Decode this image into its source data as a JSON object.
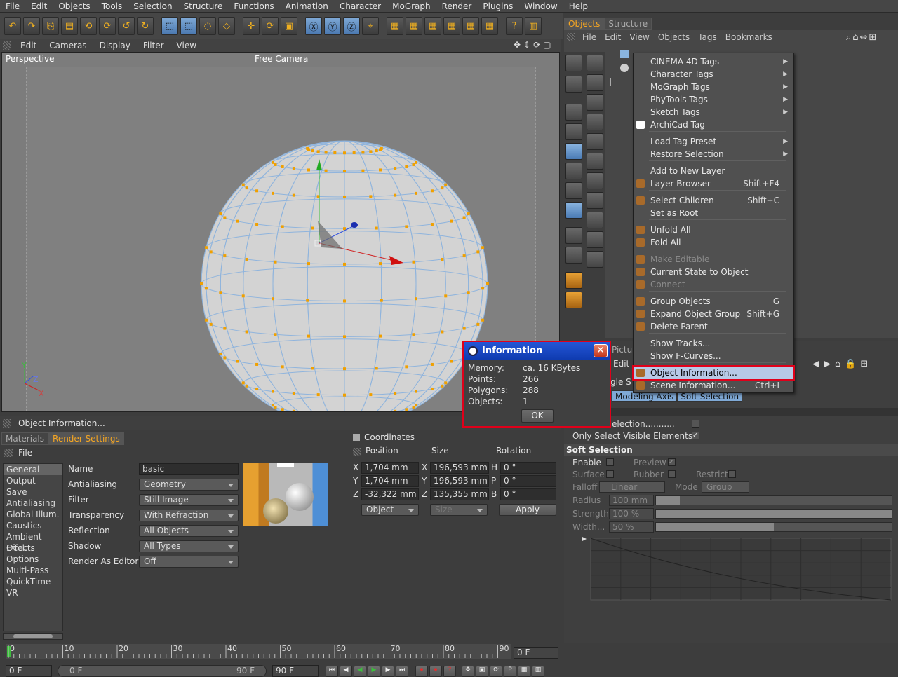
{
  "menubar": [
    "File",
    "Edit",
    "Objects",
    "Tools",
    "Selection",
    "Structure",
    "Functions",
    "Animation",
    "Character",
    "MoGraph",
    "Render",
    "Plugins",
    "Window",
    "Help"
  ],
  "viewport": {
    "menu": [
      "Edit",
      "Cameras",
      "Display",
      "Filter",
      "View"
    ],
    "label": "Perspective",
    "camera": "Free Camera"
  },
  "objects_panel": {
    "tabs": [
      "Objects",
      "Structure"
    ],
    "menu": [
      "File",
      "Edit",
      "View",
      "Objects",
      "Tags",
      "Bookmarks"
    ]
  },
  "context_menu": [
    {
      "label": "CINEMA 4D Tags",
      "arrow": true
    },
    {
      "label": "Character Tags",
      "arrow": true
    },
    {
      "label": "MoGraph Tags",
      "arrow": true
    },
    {
      "label": "PhyTools Tags",
      "arrow": true
    },
    {
      "label": "Sketch Tags",
      "arrow": true
    },
    {
      "label": "ArchiCad Tag"
    },
    {
      "label": "Load Tag Preset",
      "arrow": true
    },
    {
      "label": "Restore Selection",
      "arrow": true
    },
    {
      "label": "Add to New Layer"
    },
    {
      "label": "Layer Browser",
      "shortcut": "Shift+F4"
    },
    {
      "label": "Select Children",
      "shortcut": "Shift+C"
    },
    {
      "label": "Set as Root"
    },
    {
      "label": "Unfold All"
    },
    {
      "label": "Fold All"
    },
    {
      "label": "Make Editable",
      "disabled": true
    },
    {
      "label": "Current State to Object"
    },
    {
      "label": "Connect",
      "disabled": true
    },
    {
      "label": "Group Objects",
      "shortcut": "G"
    },
    {
      "label": "Expand Object Group",
      "shortcut": "Shift+G"
    },
    {
      "label": "Delete Parent"
    },
    {
      "label": "Show Tracks..."
    },
    {
      "label": "Show F-Curves..."
    },
    {
      "label": "Object Information...",
      "highlighted": true
    },
    {
      "label": "Scene Information...",
      "shortcut": "Ctrl+I"
    }
  ],
  "info_dialog": {
    "title": "Information",
    "rows": [
      {
        "k": "Memory:",
        "v": "ca. 16 KBytes"
      },
      {
        "k": "Points:",
        "v": "266"
      },
      {
        "k": "Polygons:",
        "v": "288"
      },
      {
        "k": "Objects:",
        "v": "1"
      }
    ],
    "ok": "OK"
  },
  "status": "Object Information...",
  "bottom_tabs": [
    "Materials",
    "Render Settings"
  ],
  "render_settings": {
    "file_label": "File",
    "list": [
      "General",
      "Output",
      "Save",
      "Antialiasing",
      "Global Illum.",
      "Caustics",
      "Ambient Occl.",
      "Effects",
      "Options",
      "Multi-Pass",
      "QuickTime VR"
    ],
    "fields": [
      {
        "label": "Name",
        "value": "basic"
      },
      {
        "label": "Antialiasing",
        "value": "Geometry"
      },
      {
        "label": "Filter",
        "value": "Still Image"
      },
      {
        "label": "Transparency",
        "value": "With Refraction"
      },
      {
        "label": "Reflection",
        "value": "All Objects"
      },
      {
        "label": "Shadow",
        "value": "All Types"
      },
      {
        "label": "Render As Editor",
        "value": "Off"
      }
    ]
  },
  "coordinates": {
    "title": "Coordinates",
    "headers": [
      "Position",
      "Size",
      "Rotation"
    ],
    "rows": [
      {
        "pl": "X",
        "pv": "1,704 mm",
        "sl": "X",
        "sv": "196,593 mm",
        "rl": "H",
        "rv": "0 °"
      },
      {
        "pl": "Y",
        "pv": "1,704 mm",
        "sl": "Y",
        "sv": "196,593 mm",
        "rl": "P",
        "rv": "0 °"
      },
      {
        "pl": "Z",
        "pv": "-32,322 mm",
        "sl": "Z",
        "sv": "135,355 mm",
        "rl": "B",
        "rv": "0 °"
      }
    ],
    "mode": "Object",
    "size_mode": "Size",
    "apply": "Apply"
  },
  "attributes": {
    "partial_tab": "Pictu",
    "partial_edit": "Edit",
    "partial_gle": "gle S",
    "tabs": [
      "Modeling Axis",
      "Soft Selection"
    ],
    "partial_selection": "election...........",
    "only_visible": "Only Select Visible Elements",
    "section": "Soft Selection",
    "enable": "Enable",
    "preview": "Preview",
    "surface": "Surface",
    "rubber": "Rubber",
    "restrict": "Restrict",
    "falloff": "Falloff",
    "falloff_val": "Linear",
    "mode": "Mode",
    "mode_val": "Group",
    "radius": "Radius",
    "radius_val": "100 mm",
    "strength": "Strength",
    "strength_val": "100 %",
    "width": "Width...",
    "width_val": "50 %"
  },
  "timeline": {
    "ticks": [
      "0",
      "10",
      "20",
      "30",
      "40",
      "50",
      "60",
      "70",
      "80",
      "90"
    ],
    "current": "0 F",
    "start": "0 F",
    "range_start": "0 F",
    "range_end": "90 F",
    "end": "90 F"
  }
}
